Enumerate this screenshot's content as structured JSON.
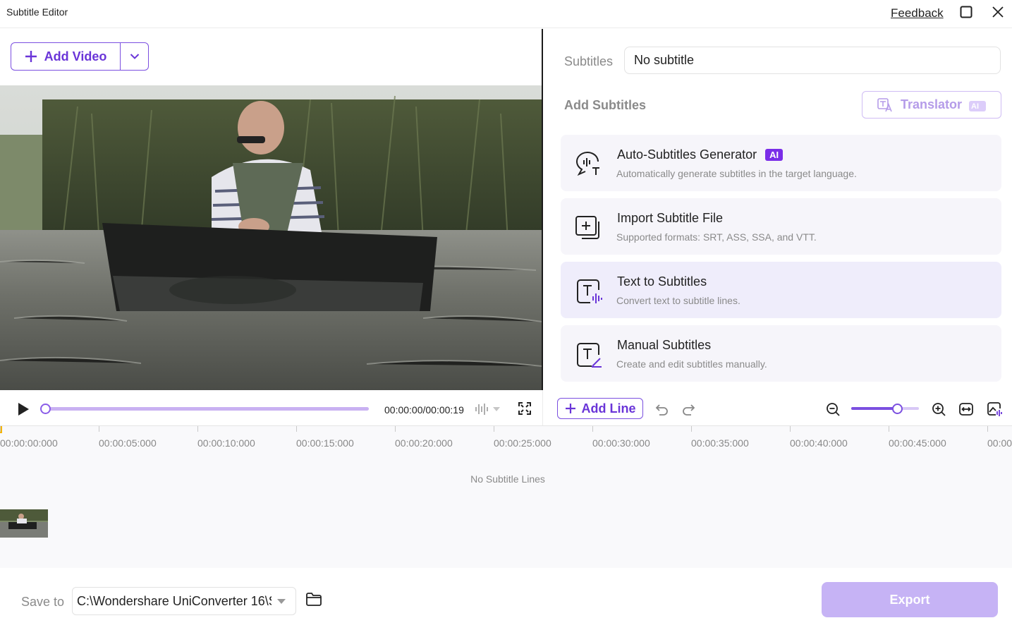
{
  "window": {
    "title": "Subtitle Editor",
    "feedback_label": "Feedback"
  },
  "video": {
    "add_label": "Add Video",
    "time": "00:00:00/00:00:19",
    "progress": 0
  },
  "right_panel": {
    "subtitles_label": "Subtitles",
    "subtitles_value": "No subtitle",
    "add_heading": "Add Subtitles",
    "translator_label": "Translator",
    "translator_badge": "AI",
    "options": [
      {
        "title": "Auto-Subtitles Generator",
        "badge": "AI",
        "desc": "Automatically generate subtitles in the target language."
      },
      {
        "title": "Import Subtitle File",
        "desc": "Supported formats: SRT, ASS, SSA, and VTT."
      },
      {
        "title": "Text to Subtitles",
        "desc": "Convert text to subtitle lines."
      },
      {
        "title": "Manual Subtitles",
        "desc": "Create and edit subtitles manually."
      }
    ]
  },
  "toolbar": {
    "add_line_label": "Add Line",
    "zoom_level": 0.68
  },
  "timeline": {
    "ticks": [
      "00:00:00:000",
      "00:00:05:000",
      "00:00:10:000",
      "00:00:15:000",
      "00:00:20:000",
      "00:00:25:000",
      "00:00:30:000",
      "00:00:35:000",
      "00:00:40:000",
      "00:00:45:000",
      "00:00"
    ],
    "empty_message": "No Subtitle Lines"
  },
  "footer": {
    "save_label": "Save to",
    "save_path": "C:\\Wondershare UniConverter 16\\S",
    "export_label": "Export"
  },
  "colors": {
    "accent": "#7b4fe0",
    "accent_light": "#c6b3f5",
    "ai_badge": "#7a2de8"
  }
}
